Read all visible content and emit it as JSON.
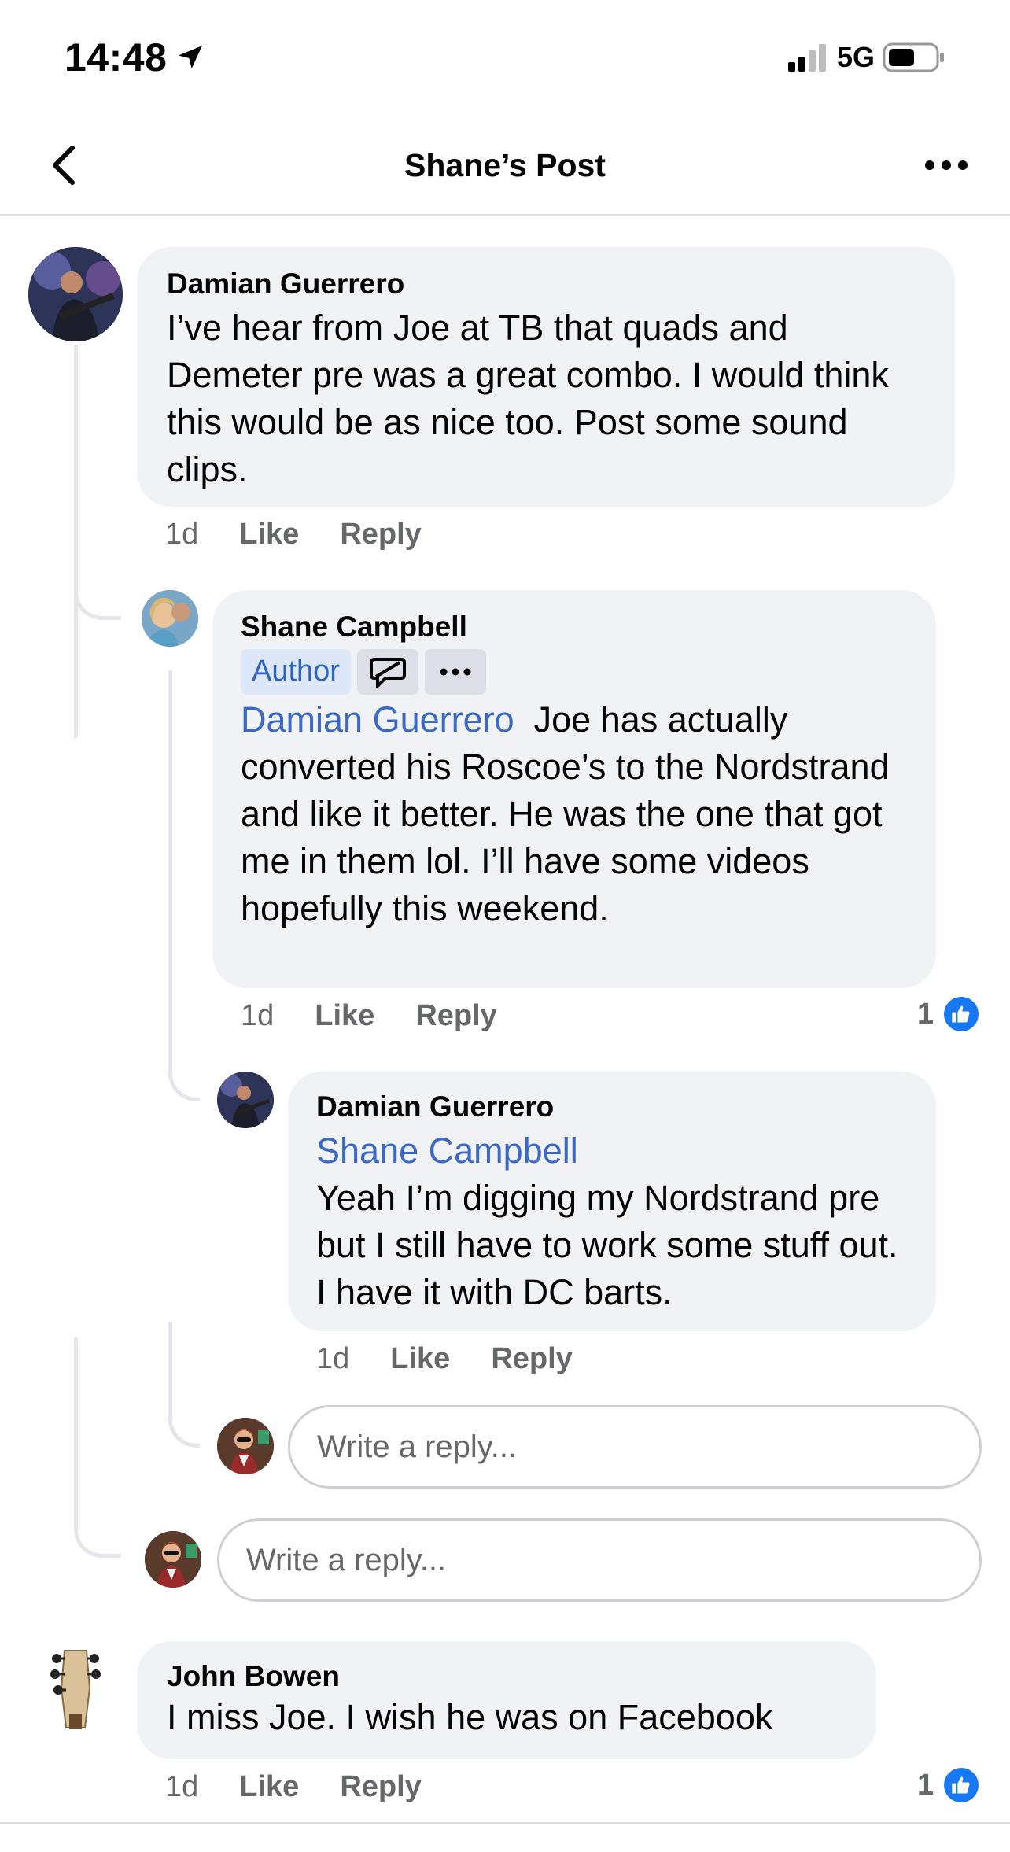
{
  "status_bar": {
    "time": "14:48",
    "network": "5G"
  },
  "header": {
    "title": "Shane’s Post"
  },
  "comments": [
    {
      "author": "Damian Guerrero",
      "text": "I’ve hear from Joe at TB that quads and Demeter pre was a great combo. I would think this would be as nice too. Post some sound clips.",
      "time": "1d",
      "like": "Like",
      "reply": "Reply"
    },
    {
      "author": "Shane Campbell",
      "badge": "Author",
      "mention": "Damian Guerrero",
      "text": "Joe has actually converted his Roscoe’s to the Nordstrand and like it better. He was the one that got me in them lol. I’ll have some videos hopefully this weekend.",
      "time": "1d",
      "like": "Like",
      "reply": "Reply",
      "reactions": "1"
    },
    {
      "author": "Damian Guerrero",
      "mention": "Shane Campbell",
      "text": "Yeah I’m digging my Nordstrand pre but I still have to work some stuff out. I have it with DC barts.",
      "time": "1d",
      "like": "Like",
      "reply": "Reply"
    },
    {
      "author": "John Bowen",
      "text": "I miss Joe. I wish he was on Facebook",
      "time": "1d",
      "like": "Like",
      "reply": "Reply",
      "reactions": "1"
    }
  ],
  "reply_placeholder": "Write a reply...",
  "colors": {
    "accent": "#1877f2",
    "mention": "#3b69c4",
    "bubble": "#f0f2f5"
  }
}
